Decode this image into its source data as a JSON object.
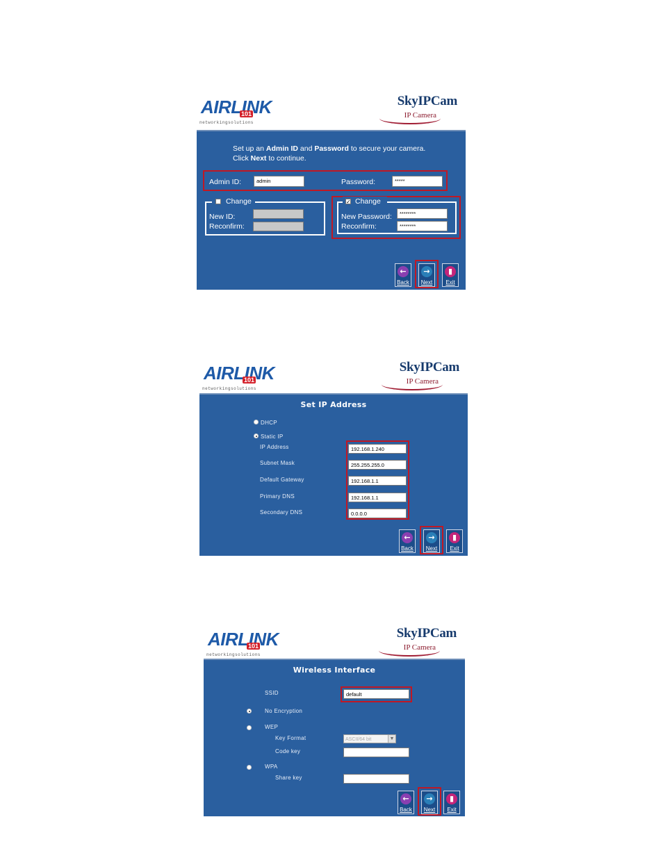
{
  "brand": {
    "logo_main": "AIRLINK",
    "logo_num": "101",
    "logo_tag": "networkingsolutions",
    "product": "SkyIPCam",
    "product_sub": "IP Camera"
  },
  "nav": {
    "back": "Back",
    "next": "Next",
    "exit": "Exit"
  },
  "panel1": {
    "intro_line1_a": "Set up an ",
    "intro_line1_b": "Admin ID",
    "intro_line1_c": " and ",
    "intro_line1_d": "Password",
    "intro_line1_e": " to secure your camera.",
    "intro_line2_a": "Click ",
    "intro_line2_b": "Next",
    "intro_line2_c": " to continue.",
    "admin_id_label": "Admin ID:",
    "admin_id_value": "admin",
    "password_label": "Password:",
    "password_value": "*****",
    "change_id_label": "Change",
    "new_id_label": "New ID:",
    "reconfirm_id_label": "Reconfirm:",
    "change_pw_label": "Change",
    "new_password_label": "New Password:",
    "reconfirm_pw_label": "Reconfirm:",
    "new_password_value": "********",
    "reconfirm_pw_value": "********"
  },
  "panel2": {
    "title": "Set IP Address",
    "dhcp_label": "DHCP",
    "static_label": "Static IP",
    "fields": [
      {
        "label": "IP Address",
        "value": "192.168.1.240"
      },
      {
        "label": "Subnet Mask",
        "value": "255.255.255.0"
      },
      {
        "label": "Default Gateway",
        "value": "192.168.1.1"
      },
      {
        "label": "Primary DNS",
        "value": "192.168.1.1"
      },
      {
        "label": "Secondary DNS",
        "value": "0.0.0.0"
      }
    ]
  },
  "panel3": {
    "title": "Wireless Interface",
    "ssid_label": "SSID",
    "ssid_value": "default",
    "no_enc_label": "No Encryption",
    "wep_label": "WEP",
    "key_format_label": "Key Format",
    "key_format_value": "ASCII/64 bit",
    "code_key_label": "Code key",
    "wpa_label": "WPA",
    "share_key_label": "Share key"
  }
}
